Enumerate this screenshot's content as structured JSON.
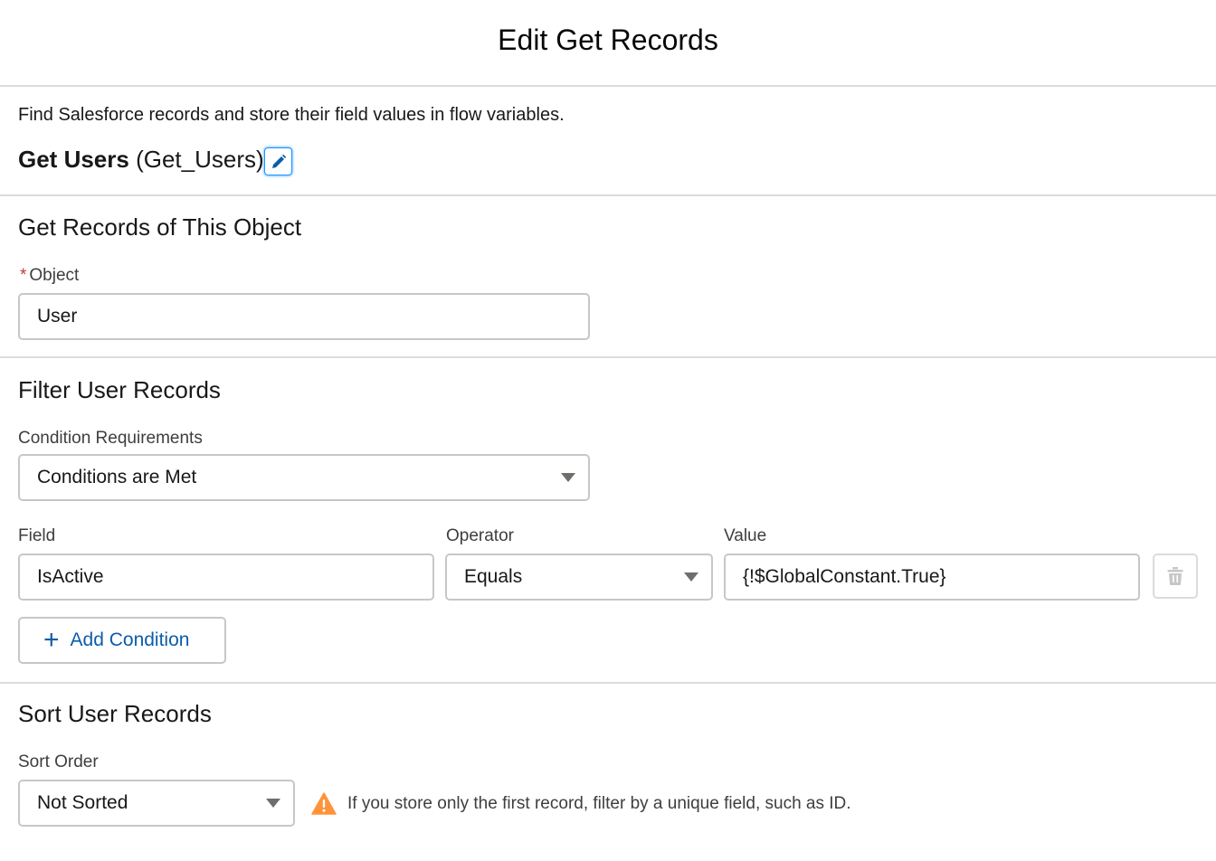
{
  "modal": {
    "title": "Edit Get Records"
  },
  "element": {
    "description": "Find Salesforce records and store their field values in flow variables.",
    "label": "Get Users",
    "api_name": "(Get_Users)"
  },
  "object_section": {
    "heading": "Get Records of This Object",
    "object_label": "Object",
    "required_mark": "*",
    "object_value": "User"
  },
  "filter_section": {
    "heading": "Filter User Records",
    "condition_label": "Condition Requirements",
    "condition_value": "Conditions are Met",
    "field_label": "Field",
    "operator_label": "Operator",
    "value_label": "Value",
    "field_value": "IsActive",
    "operator_value": "Equals",
    "value_value": "{!$GlobalConstant.True}",
    "add_condition_label": "Add Condition"
  },
  "sort_section": {
    "heading": "Sort User Records",
    "sort_order_label": "Sort Order",
    "sort_order_value": "Not Sorted",
    "warning_text": "If you store only the first record, filter by a unique field, such as ID."
  },
  "icons": {
    "edit": "pencil-icon",
    "delete": "trash-icon",
    "add": "plus-icon",
    "warning": "warning-icon",
    "dropdown": "chevron-down-icon"
  },
  "colors": {
    "accent": "#0b5cab",
    "focus": "#1b96ff",
    "warning": "#fe9339",
    "required": "#c23934",
    "divider": "#dddbda"
  }
}
